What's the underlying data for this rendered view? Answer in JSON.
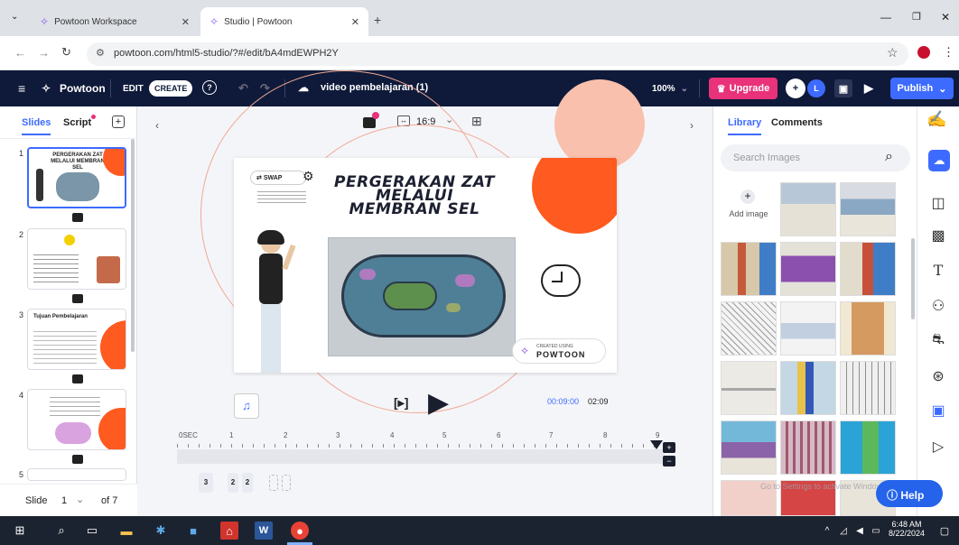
{
  "browser": {
    "tabs": [
      {
        "label": "Powtoon Workspace"
      },
      {
        "label": "Studio | Powtoon"
      }
    ],
    "url": "powtoon.com/html5-studio/?#/edit/bA4mdEWPH2Y"
  },
  "header": {
    "brand": "Powtoon",
    "edit_label": "EDIT",
    "create_label": "CREATE",
    "project_title": "video pembelajaran (1)",
    "zoom": "100%",
    "upgrade_label": "Upgrade",
    "avatar_letter": "L",
    "publish_label": "Publish"
  },
  "left_panel": {
    "tab_slides": "Slides",
    "tab_script": "Script",
    "slide_numbers": [
      "1",
      "2",
      "3",
      "4",
      "5"
    ],
    "thumb1_title": "PERGERAKAN ZAT MELALUI MEMBRAN SEL",
    "thumb3_title": "Tujuan Pembelajaran",
    "slide_label": "Slide",
    "slide_current": "1",
    "slide_total": "of 7"
  },
  "canvas": {
    "aspect": "16:9",
    "slide_title": "PERGERAKAN ZAT MELALUI MEMBRAN SEL",
    "swap_label": "SWAP",
    "created_using": "CREATED USING",
    "watermark": "POWTOON",
    "time_current": "00:09:00",
    "time_total": "02:09",
    "timeline_ticks": [
      "0SEC",
      "1",
      "2",
      "3",
      "4",
      "5",
      "6",
      "7",
      "8",
      "9"
    ],
    "layers": [
      "3",
      "2",
      "2"
    ]
  },
  "right_panel": {
    "tab_library": "Library",
    "tab_comments": "Comments",
    "search_placeholder": "Search Images",
    "add_image_label": "Add image",
    "help_label": "Help",
    "watermark_text": "Go to Settings to activate Windows."
  },
  "taskbar": {
    "time": "6:48 AM",
    "date": "8/22/2024"
  },
  "colors": {
    "header_bg": "#0f1a3a",
    "upgrade": "#e8327a",
    "publish": "#3d6bff",
    "accent_orange": "#ff5a1f",
    "help": "#2563eb"
  }
}
